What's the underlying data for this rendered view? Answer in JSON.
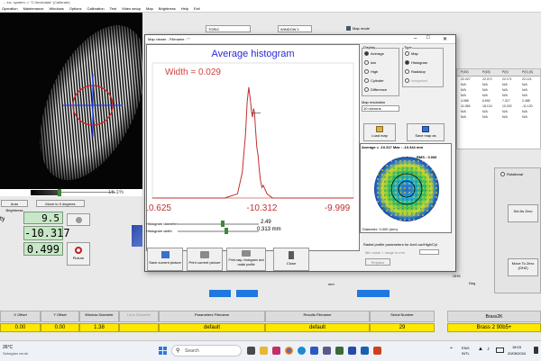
{
  "title_bar": "... Inc. system -> \"C:\\lens\\data\" (Calibrate)",
  "menu": [
    "Operation",
    "Maintenance",
    "Windows",
    "Options",
    "Calibration",
    "Test",
    "Video setup",
    "Map",
    "Brightness",
    "Help",
    "Exit"
  ],
  "camera": {
    "scale_pct": "16.1%",
    "auto_brightness": "Auto Brightness",
    "move_zero": "Move to 0 degrees",
    "readout1_label": "ty",
    "readout1": "9.5",
    "readout2": "-10.317",
    "readout3": "0.499",
    "picture_label": "Picture"
  },
  "top_controls": {
    "type_select": "TORIC",
    "window_select": "WINDOW 1",
    "map_mode": "Map mode"
  },
  "dialog": {
    "title": "Map viewer - Filename : \"\"",
    "close": "✕",
    "plot_title": "Average histogram",
    "width_text": "Width = 0.029",
    "x_ticks": [
      "-10.625",
      "-10.312",
      "-9.999"
    ],
    "display_group": "Display",
    "display_options": [
      "Average",
      "low",
      "High",
      "Cylinder",
      "Difference"
    ],
    "display_selected": 0,
    "type_group": "Type",
    "type_options": [
      "Map",
      "Histogram",
      "Radialop",
      "Integrated"
    ],
    "type_selected": 1,
    "map_resolution_label": "Map resolution",
    "map_resolution": "10 microns",
    "load_map": "Load map",
    "save_map": "Save map as",
    "map_avg": "Average = -10.317 Max : -10.344 mm",
    "map_rms": "RMS : 0.008",
    "map_diam": "Diameter: 0.000 (mm)",
    "radial_label": "Radial profile parameters for Avr/Low/High/Cyl",
    "radial_value_label": "Min value = range in mm",
    "radial_button": "Replace",
    "histo_diameter_label": "Histogram diameter",
    "histo_diameter": "2.49",
    "histo_width_label": "Histogram width",
    "histo_width": "0.313 mm",
    "buttons": [
      "Save current picture",
      "Print current picture",
      "Print map, histogram and radial profile",
      "Close"
    ]
  },
  "table": {
    "headers": [
      "P(45)",
      "P(45)",
      "P(0)",
      "P(0) (S)"
    ],
    "rows": [
      [
        "22.027",
        "22.072",
        "22.171",
        "22.121"
      ],
      [
        "N/A",
        "N/A",
        "N/A",
        "N/A"
      ],
      [
        "N/A",
        "N/A",
        "N/A",
        "N/A"
      ],
      [
        "N/A",
        "N/A",
        "N/A",
        "N/A"
      ],
      [
        "4.086",
        "6.692",
        "7.317",
        "2.485"
      ],
      [
        "11.055",
        "18.124",
        "10.202",
        "-11.120"
      ],
      [
        "N/A",
        "N/A",
        "N/A",
        "N/A"
      ],
      [
        "N/A",
        "N/A",
        "N/A",
        "N/A"
      ]
    ]
  },
  "right_panel": {
    "rotational": "Rotational",
    "set_as_zero": "Set As Zero",
    "move_to_zero": "Move To Zero (OHZ)",
    "deg": "Deg",
    "ohs": "OHS",
    "mm": "mm"
  },
  "bottom_table": {
    "headers": [
      "X Offset",
      "Y Offset",
      "Window Diameter",
      "Lens Diameter",
      "Parameters Filename",
      "Results Filename",
      "Serial Number"
    ],
    "values": [
      "0.00",
      "0.00",
      "1.38",
      "",
      "default",
      "default",
      "29"
    ],
    "brass_label": "Brass2K",
    "brass_value": "Brass 2 90b5+"
  },
  "taskbar": {
    "weather_temp": "26°C",
    "weather_text": "Sebagian cerah",
    "search": "Search",
    "lang1": "ENG",
    "lang2": "INTL",
    "time": "18:03",
    "date": "20/05/2024"
  },
  "chart_data": {
    "type": "line",
    "title": "Average histogram",
    "annotation": "Width = 0.029",
    "x_ticks": [
      "-10.625",
      "-10.312",
      "-9.999"
    ],
    "xlim": [
      -10.625,
      -9.999
    ],
    "series": [
      {
        "x": [
          -10.625,
          -10.4,
          -10.36,
          -10.345,
          -10.335,
          -10.33,
          -10.325,
          -10.32,
          -10.316,
          -10.313,
          -10.31,
          -10.307,
          -10.304,
          -10.3,
          -10.296,
          -10.292,
          -10.288,
          -10.284,
          -10.28,
          -10.274,
          -10.268,
          -10.26,
          -10.25,
          -9.999
        ],
        "y": [
          0,
          0,
          0.02,
          0.12,
          0.3,
          0.45,
          0.52,
          0.46,
          0.4,
          0.38,
          0.42,
          0.4,
          0.33,
          0.24,
          0.2,
          0.13,
          0.08,
          0.05,
          0.06,
          0.04,
          0.02,
          0.01,
          0,
          0
        ]
      }
    ]
  }
}
